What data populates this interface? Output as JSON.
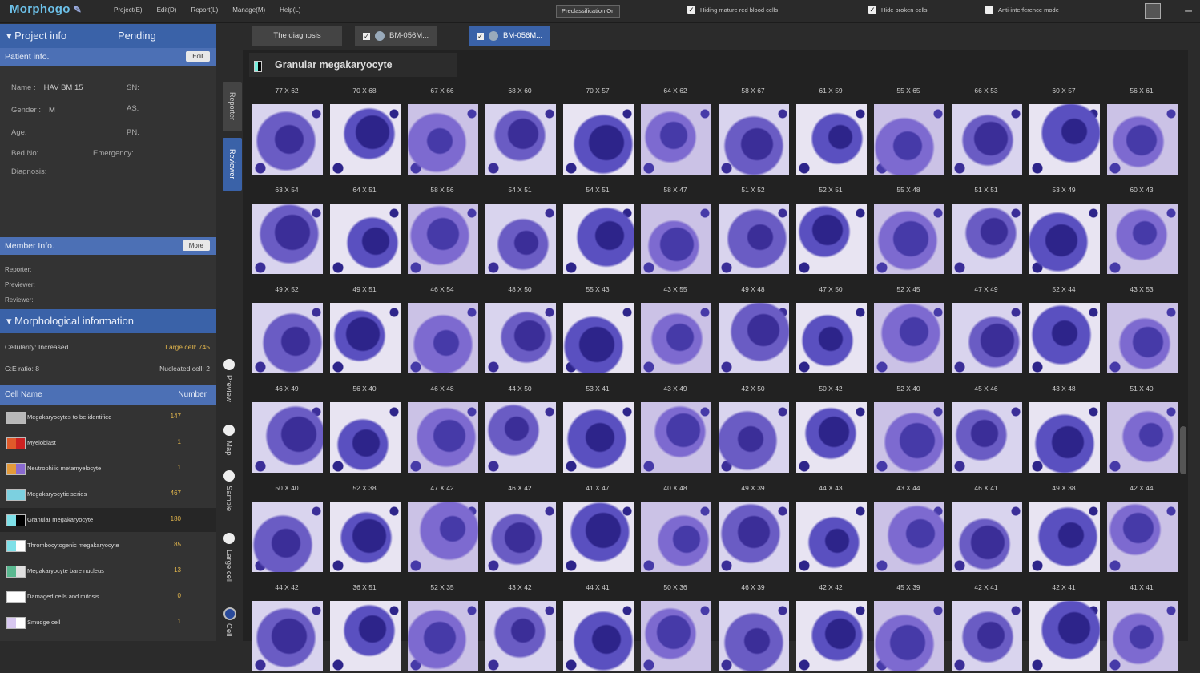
{
  "app": {
    "name": "Morphogo",
    "pen_icon": "edit-icon"
  },
  "menu": [
    "Project(E)",
    "Edit(D)",
    "Report(L)",
    "Manage(M)",
    "Help(L)"
  ],
  "toolbar": {
    "pre_classification": "Preclassification On",
    "hide_mature_rbc": "Hiding mature red blood cells",
    "hide_broken": "Hide broken cells",
    "anti_interference": "Anti-interference mode"
  },
  "project": {
    "title": "Project info",
    "status": "Pending",
    "patient_info_label": "Patient info.",
    "edit_label": "Edit",
    "name_label": "Name :",
    "name_value": "HAV BM 15",
    "sn_label": "SN:",
    "gender_label": "Gender :",
    "gender_value": "M",
    "as_label": "AS:",
    "age_label": "Age:",
    "pn_label": "PN:",
    "bed_label": "Bed No:",
    "emergency_label": "Emergency:",
    "diagnosis_label": "Diagnosis:"
  },
  "member": {
    "title": "Member Info.",
    "more_label": "More",
    "reporter": "Reporter:",
    "previewer": "Previewer:",
    "reviewer": "Reviewer:"
  },
  "morph": {
    "title": "Morphological information",
    "cellularity": "Cellularity: Increased",
    "large_cell": "Large cell: 745",
    "ge_ratio": "G:E ratio: 8",
    "nucleated": "Nucleated cell: 2",
    "col_name": "Cell Name",
    "col_number": "Number"
  },
  "cells": [
    {
      "name": "Megakaryocytes to be identified",
      "num": "147",
      "color": "#b8b8b8",
      "color2": "#b8b8b8"
    },
    {
      "name": "Myeloblast",
      "num": "1",
      "color": "#e05a2a",
      "color2": "#cc2222"
    },
    {
      "name": "Neutrophilic metamyelocyte",
      "num": "1",
      "color": "#e39a3a",
      "color2": "#8a6ad0"
    },
    {
      "name": "Megakaryocytic series",
      "num": "467",
      "color": "#7cd0e0",
      "color2": "#7cd0e0"
    },
    {
      "name": "Granular megakaryocyte",
      "num": "180",
      "color": "#7ee0e8",
      "color2": "#000000"
    },
    {
      "name": "Thrombocytogenic megakaryocyte",
      "num": "85",
      "color": "#7ee0e8",
      "color2": "#ffffff"
    },
    {
      "name": "Megakaryocyte bare nucleus",
      "num": "13",
      "color": "#5ab890",
      "color2": "#e0e0e0"
    },
    {
      "name": "Damaged cells and mitosis",
      "num": "0",
      "color": "#ffffff",
      "color2": "#ffffff"
    },
    {
      "name": "Smudge cell",
      "num": "1",
      "color": "#d8c8f0",
      "color2": "#ffffff"
    }
  ],
  "vtabs": {
    "reporter": "Reporter",
    "reviewer": "Reviewer"
  },
  "views": [
    "Preview",
    "Map",
    "Sample",
    "Large cell",
    "Cell"
  ],
  "tabs": [
    {
      "label": "The diagnosis"
    },
    {
      "label": "BM-056M..."
    },
    {
      "label": "BM-056M..."
    }
  ],
  "category": "Granular megakaryocyte",
  "thumbs": [
    [
      "77 X 62",
      "70 X 68",
      "67 X 66",
      "68 X 60",
      "70 X 57",
      "64 X 62",
      "58 X 67",
      "61 X 59",
      "55 X 65",
      "66 X 53",
      "60 X 57",
      "56 X 61"
    ],
    [
      "63 X 54",
      "64 X 51",
      "58 X 56",
      "54 X 51",
      "54 X 51",
      "58 X 47",
      "51 X 52",
      "52 X 51",
      "55 X 48",
      "51 X 51",
      "53 X 49",
      "60 X 43"
    ],
    [
      "49 X 52",
      "49 X 51",
      "46 X 54",
      "48 X 50",
      "55 X 43",
      "43 X 55",
      "49 X 48",
      "47 X 50",
      "52 X 45",
      "47 X 49",
      "52 X 44",
      "43 X 53"
    ],
    [
      "46 X 49",
      "56 X 40",
      "46 X 48",
      "44 X 50",
      "53 X 41",
      "43 X 49",
      "42 X 50",
      "50 X 42",
      "52 X 40",
      "45 X 46",
      "43 X 48",
      "51 X 40"
    ],
    [
      "50 X 40",
      "52 X 38",
      "47 X 42",
      "46 X 42",
      "41 X 47",
      "40 X 48",
      "49 X 39",
      "44 X 43",
      "43 X 44",
      "46 X 41",
      "49 X 38",
      "42 X 44"
    ],
    [
      "44 X 42",
      "36 X 51",
      "52 X 35",
      "43 X 42",
      "44 X 41",
      "50 X 36",
      "46 X 39",
      "42 X 42",
      "45 X 39",
      "42 X 41",
      "42 X 41",
      "41 X 41"
    ]
  ]
}
